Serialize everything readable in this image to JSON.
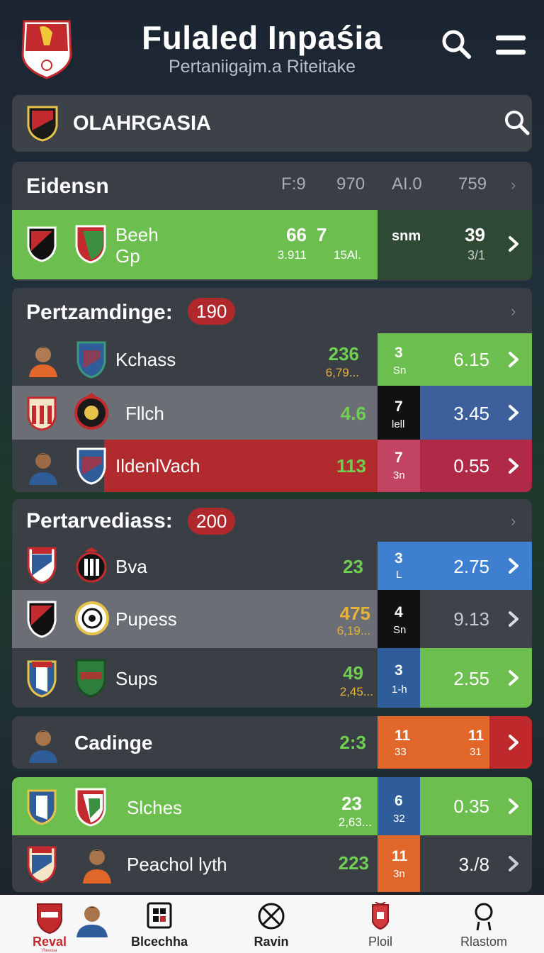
{
  "header": {
    "title": "Fulaled Inpaśia",
    "subtitle": "Pertaniigajm.a Riteitake"
  },
  "search": {
    "label": "OLAHRGASIA"
  },
  "featured": {
    "heading": "Eidensn",
    "columns": [
      "F:9",
      "970",
      "AI.0",
      "759"
    ],
    "row": {
      "name_line1": "Beeh",
      "name_line2": "Gp",
      "v1": "66",
      "v1_sub": "3.911",
      "v2": "7",
      "v2_sub": "15Al.",
      "mid_label": "snm",
      "odds": "39",
      "odds_sub": "3/1",
      "colors": {
        "left": "#6cbf4f",
        "right": "#2f4a34"
      }
    }
  },
  "section1": {
    "heading": "Pertzamdinge:",
    "badge": "190",
    "rows": [
      {
        "name": "Kchass",
        "v1": "236",
        "v1_sub": "6,79...",
        "mid_top": "3",
        "mid_bot": "Sn",
        "odds": "6.15",
        "bg": "#3a3e45",
        "mid_bg": "#6cbf4f",
        "odds_bg": "#6cbf4f",
        "v1_color": "#6fcf52"
      },
      {
        "name": "Fllch",
        "v1": "4.6",
        "v1_sub": "",
        "mid_top": "7",
        "mid_bot": "lell",
        "odds": "3.45",
        "bg": "#6b6f75",
        "mid_bg": "#111111",
        "odds_bg": "#3d5f9c",
        "v1_color": "#6fcf52"
      },
      {
        "name": "IldenlVach",
        "v1": "113",
        "v1_sub": "",
        "mid_top": "7",
        "mid_bot": "3n",
        "odds": "0.55",
        "bg": "#b02a2e",
        "mid_bg": "#c24462",
        "odds_bg": "#b02a48",
        "v1_color": "#6fcf52"
      }
    ]
  },
  "section2": {
    "heading": "Pertarvediass:",
    "badge": "200",
    "rows": [
      {
        "name": "Bva",
        "v1": "23",
        "v1_sub": "",
        "mid_top": "3",
        "mid_bot": "L",
        "odds": "2.75",
        "bg": "#3a3e45",
        "mid_bg": "#3f7fd0",
        "odds_bg": "#3f7fd0",
        "v1_color": "#6fcf52"
      },
      {
        "name": "Pupess",
        "v1": "475",
        "v1_sub": "6,19...",
        "mid_top": "4",
        "mid_bot": "Sn",
        "odds": "9.13",
        "bg": "#6b6f75",
        "mid_bg": "#111111",
        "odds_bg": "#3f4349",
        "v1_color": "#e6b23a"
      },
      {
        "name": "Sups",
        "v1": "49",
        "v1_sub": "2,45...",
        "mid_top": "3",
        "mid_bot": "1-h",
        "odds": "2.55",
        "bg": "#3a3e45",
        "mid_bg": "#2f5d9a",
        "odds_bg": "#6cbf4f",
        "v1_color": "#6fcf52"
      }
    ]
  },
  "single": {
    "name": "Cadinge",
    "v1": "2:3",
    "mid_top": "11",
    "mid_bot": "33",
    "odds_top": "11",
    "odds_bot": "31",
    "colors": {
      "mid": "#e0662a",
      "odds": "#e0662a",
      "arrow": "#c0292c"
    }
  },
  "bottom_rows": [
    {
      "name": "Slches",
      "v1": "23",
      "v1_sub": "2,63...",
      "mid_top": "6",
      "mid_bot": "32",
      "odds": "0.35",
      "bg": "#6cbf4f",
      "mid_bg": "#2f5d9a",
      "odds_bg": "#6cbf4f"
    },
    {
      "name": "Peachol lyth",
      "v1": "223",
      "v1_sub": "",
      "mid_top": "11",
      "mid_bot": "3n",
      "odds": "3./8",
      "bg": "#3a3e45",
      "mid_bg": "#e0662a",
      "odds_bg": "#3a3e45"
    }
  ],
  "tabs": [
    {
      "label": "Reval",
      "sub": "Resosa",
      "icon": "crest-icon"
    },
    {
      "label": "Blcechha",
      "icon": "grid-icon"
    },
    {
      "label": "Ravin",
      "icon": "ball-icon"
    },
    {
      "label": "Ploil",
      "icon": "trophy-icon"
    },
    {
      "label": "Rlastom",
      "icon": "user-icon"
    }
  ]
}
